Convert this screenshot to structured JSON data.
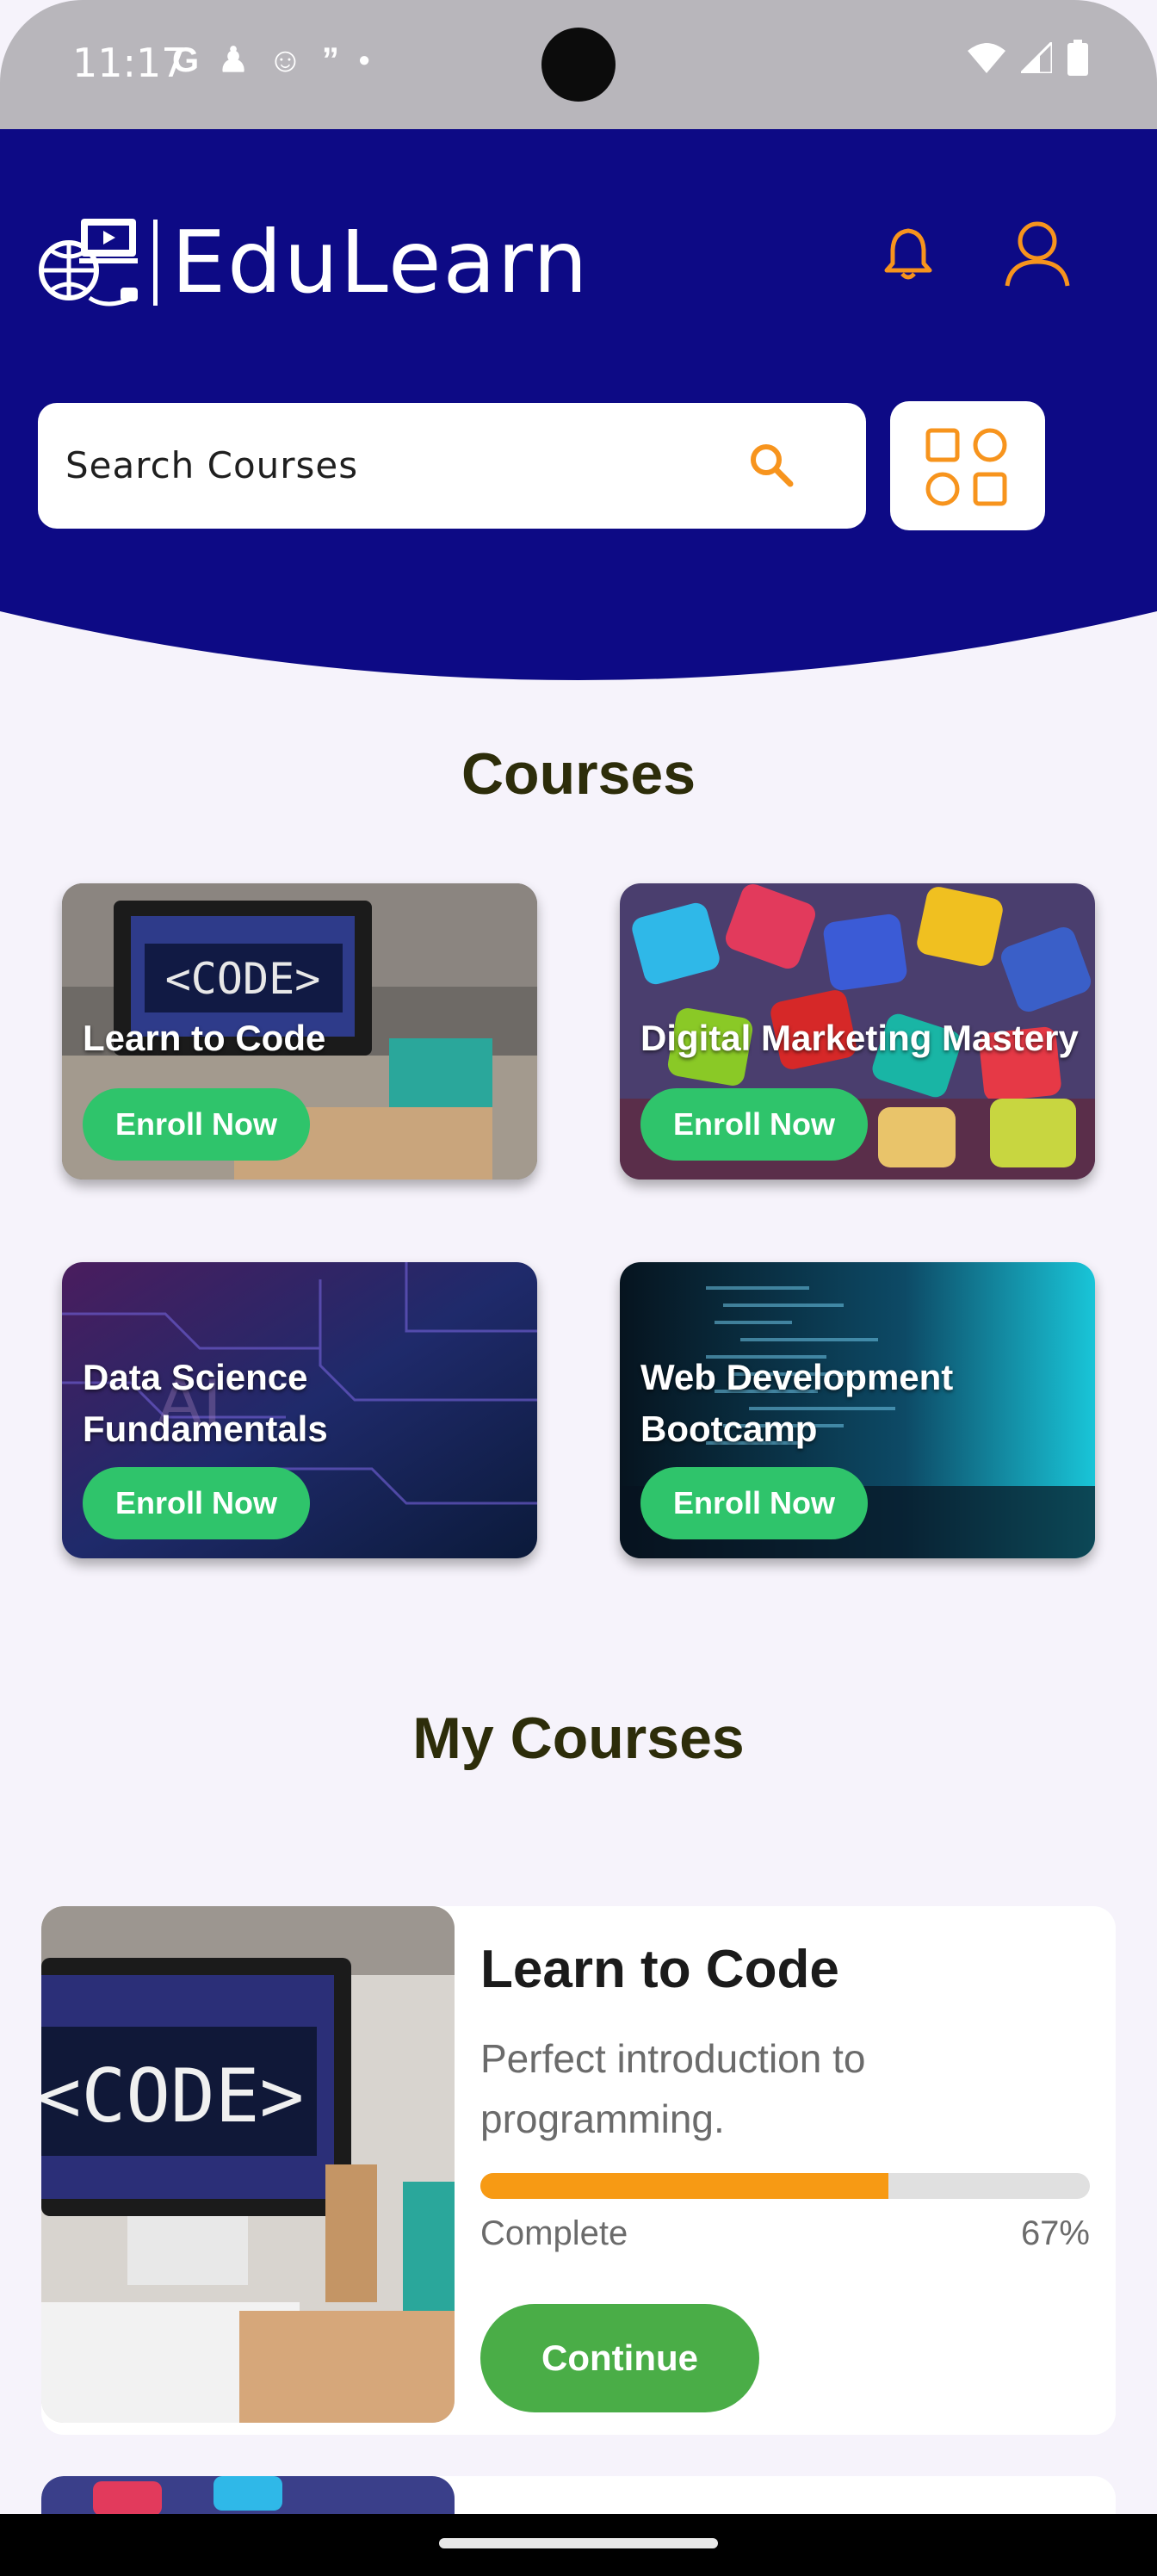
{
  "status": {
    "time": "11:17"
  },
  "app": {
    "name": "EduLearn"
  },
  "search": {
    "placeholder": "Search Courses"
  },
  "sections": {
    "courses": "Courses",
    "my_courses": "My Courses"
  },
  "courses": [
    {
      "title": "Learn to Code",
      "button": "Enroll Now"
    },
    {
      "title": "Digital Marketing Mastery",
      "button": "Enroll Now"
    },
    {
      "title": "Data Science Fundamentals",
      "button": "Enroll Now"
    },
    {
      "title": "Web Development Bootcamp",
      "button": "Enroll Now"
    }
  ],
  "my_courses": [
    {
      "title": "Learn to Code",
      "description": "Perfect introduction to programming.",
      "progress_label": "Complete",
      "progress_text": "67%",
      "progress": 0.67,
      "button": "Continue"
    }
  ],
  "colors": {
    "header": "#0d0a85",
    "accent": "#f7941d",
    "enroll": "#2fc46b",
    "continue": "#4aad47"
  }
}
